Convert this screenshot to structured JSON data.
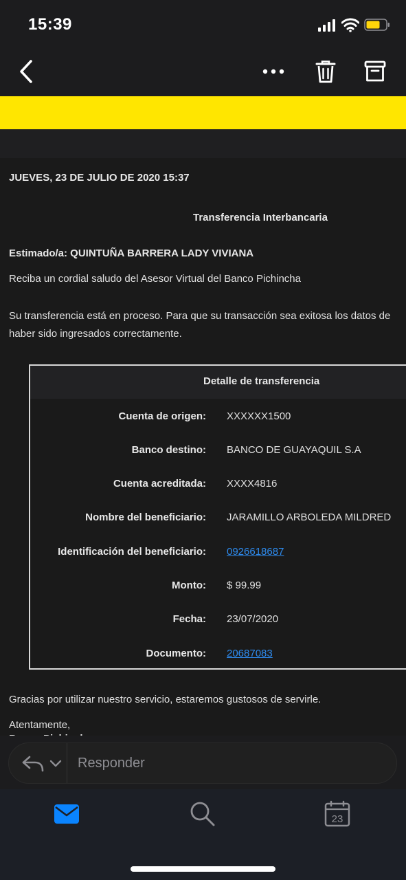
{
  "status_bar": {
    "time": "15:39",
    "battery_color": "#ffd60a"
  },
  "nav": {
    "back_icon": "chevron-left-icon",
    "more_icon": "ellipsis-icon",
    "trash_icon": "trash-icon",
    "archive_icon": "archive-icon"
  },
  "banner": {
    "color": "#ffe600"
  },
  "email": {
    "date": "JUEVES, 23 DE JULIO DE 2020 15:37",
    "heading": "Transferencia Interbancaria",
    "greeting": "Estimado/a: QUINTUÑA BARRERA LADY VIVIANA",
    "intro": "Reciba un cordial saludo del Asesor Virtual del Banco Pichincha",
    "notice": "Su transferencia está en proceso. Para que su transacción sea exitosa los datos de haber sido ingresados correctamente.",
    "details": {
      "title": "Detalle de transferencia",
      "rows": [
        {
          "label": "Cuenta de origen:",
          "value": "XXXXXX1500"
        },
        {
          "label": "Banco destino:",
          "value": "BANCO DE GUAYAQUIL S.A"
        },
        {
          "label": "Cuenta acreditada:",
          "value": "XXXX4816"
        },
        {
          "label": "Nombre del beneficiario:",
          "value": "JARAMILLO ARBOLEDA MILDRED"
        },
        {
          "label": "Identificación del beneficiario:",
          "value": "0926618687"
        },
        {
          "label": "Monto:",
          "value": "$ 99.99"
        },
        {
          "label": "Fecha:",
          "value": "23/07/2020"
        },
        {
          "label": "Documento:",
          "value": "20687083"
        }
      ]
    },
    "closing": "Gracias por utilizar nuestro servicio, estaremos gustosos de servirle.",
    "signoff": "Atentamente,",
    "signoff_name": "Banco Pichincha"
  },
  "reply": {
    "label": "Responder"
  },
  "tabs": {
    "mail_icon": "mail-icon",
    "search_icon": "search-icon",
    "calendar_icon": "calendar-icon",
    "calendar_day": "23",
    "accent": "#0a84ff"
  }
}
